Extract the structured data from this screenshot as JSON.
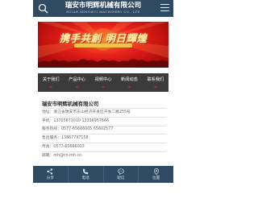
{
  "header": {
    "title": "瑞安市明辉机械有限公司",
    "subtitle": "RUIAN MINGHUI MACHINERY CO., LTD"
  },
  "banner": {
    "slogan": "携手共創 明日輝煌"
  },
  "nav": [
    {
      "label": "关于我们"
    },
    {
      "label": "产品中心"
    },
    {
      "label": "视频中心"
    },
    {
      "label": "新闻动态"
    },
    {
      "label": "联系我们"
    }
  ],
  "contact": {
    "company": "瑞安市明辉机械有限公司",
    "address": "地址：浙江省瑞安市东山经济开发区开发二路255号",
    "mobile": "手机：13705871010 13336957666",
    "service": "服务热线：0577-65666005 65602577",
    "aftersales": "售后服务：13867797158",
    "fax": "传真：0577-65666003",
    "email": "邮箱：mh@cn-mh.cn"
  },
  "footer": [
    {
      "label": "分享",
      "icon": "share-icon"
    },
    {
      "label": "电话",
      "icon": "phone-icon"
    },
    {
      "label": "短信",
      "icon": "message-icon"
    },
    {
      "label": "位置",
      "icon": "location-icon"
    }
  ],
  "colors": {
    "header_bg": "#2f4a62",
    "nav_bg": "#3b3b3b",
    "accent_red": "#c81f24",
    "banner_red": "#e8221c"
  }
}
